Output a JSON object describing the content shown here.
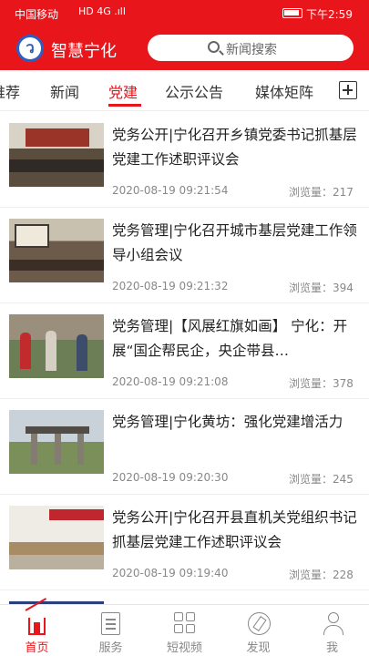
{
  "status_bar": {
    "carrier": "中国移动",
    "signal": "HD 4G .ıll",
    "time": "下午2:59"
  },
  "header": {
    "logo_char": "ว",
    "app_name": "智慧宁化",
    "search_placeholder": "新闻搜索"
  },
  "tabs": [
    {
      "label": "推荐",
      "active": false
    },
    {
      "label": "新闻",
      "active": false
    },
    {
      "label": "党建",
      "active": true
    },
    {
      "label": "公示公告",
      "active": false
    },
    {
      "label": "媒体矩阵",
      "active": false
    }
  ],
  "articles": [
    {
      "title": "党务公开|宁化召开乡镇党委书记抓基层党建工作述职评议会",
      "date": "2020-08-19 09:21:54",
      "views": "浏览量：217"
    },
    {
      "title": "党务管理|宁化召开城市基层党建工作领导小组会议",
      "date": "2020-08-19 09:21:32",
      "views": "浏览量：394"
    },
    {
      "title": "党务管理|【风展红旗如画】 宁化：开展“国企帮民企，央企带县…",
      "date": "2020-08-19 09:21:08",
      "views": "浏览量：378"
    },
    {
      "title": "党务管理|宁化黄坊：强化党建增活力",
      "date": "2020-08-19 09:20:30",
      "views": "浏览量：245"
    },
    {
      "title": "党务公开|宁化召开县直机关党组织书记抓基层党建工作述职评议会",
      "date": "2020-08-19 09:19:40",
      "views": "浏览量：228"
    }
  ],
  "bottom_nav": [
    {
      "label": "首页",
      "icon": "home-icon",
      "active": true
    },
    {
      "label": "服务",
      "icon": "service-icon",
      "active": false
    },
    {
      "label": "短视频",
      "icon": "grid-icon",
      "active": false
    },
    {
      "label": "发现",
      "icon": "discover-icon",
      "active": false
    },
    {
      "label": "我",
      "icon": "user-icon",
      "active": false
    }
  ],
  "colors": {
    "brand_red": "#e8151b",
    "text": "#222222",
    "meta": "#888888"
  }
}
